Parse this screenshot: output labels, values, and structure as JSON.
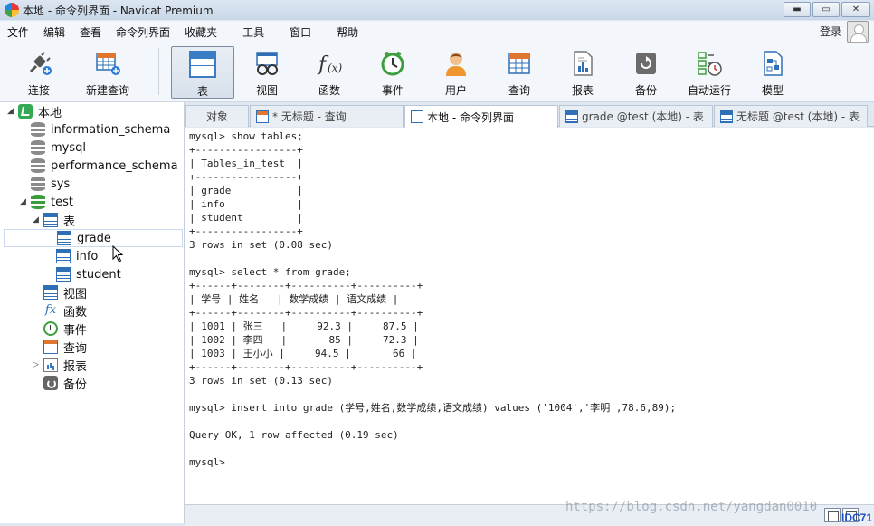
{
  "window": {
    "title": "本地 - 命令列界面 - Navicat Premium",
    "controls": {
      "minimize": "▬",
      "maximize": "▭",
      "close": "✕"
    }
  },
  "menubar": {
    "items": [
      "文件",
      "编辑",
      "查看",
      "命令列界面",
      "收藏夹",
      "工具",
      "窗口",
      "帮助"
    ],
    "login": "登录"
  },
  "toolbar": {
    "items": [
      {
        "label": "连接",
        "icon": "plug-icon"
      },
      {
        "label": "新建查询",
        "icon": "new-query-icon"
      },
      {
        "label": "表",
        "icon": "table-icon",
        "active": true
      },
      {
        "label": "视图",
        "icon": "view-icon"
      },
      {
        "label": "函数",
        "icon": "function-icon"
      },
      {
        "label": "事件",
        "icon": "event-icon"
      },
      {
        "label": "用户",
        "icon": "user-icon"
      },
      {
        "label": "查询",
        "icon": "query-icon"
      },
      {
        "label": "报表",
        "icon": "report-icon"
      },
      {
        "label": "备份",
        "icon": "backup-icon"
      },
      {
        "label": "自动运行",
        "icon": "schedule-icon"
      },
      {
        "label": "模型",
        "icon": "model-icon"
      }
    ]
  },
  "tree": {
    "connection": "本地",
    "databases": [
      "information_schema",
      "mysql",
      "performance_schema",
      "sys",
      "test"
    ],
    "test_children": {
      "tables_group": "表",
      "tables": [
        "grade",
        "info",
        "student"
      ],
      "views": "视图",
      "functions": "函数",
      "events": "事件",
      "queries": "查询",
      "reports": "报表",
      "backups": "备份"
    }
  },
  "tabs": [
    {
      "label": "对象"
    },
    {
      "label": "* 无标题 - 查询"
    },
    {
      "label": "本地 - 命令列界面",
      "active": true
    },
    {
      "label": "grade @test (本地) - 表"
    },
    {
      "label": "无标题 @test (本地) - 表"
    }
  ],
  "console": {
    "lines": [
      "mysql> show tables;",
      "+-----------------+",
      "| Tables_in_test  |",
      "+-----------------+",
      "| grade           |",
      "| info            |",
      "| student         |",
      "+-----------------+",
      "3 rows in set (0.08 sec)",
      "",
      "mysql> select * from grade;",
      "+------+--------+----------+----------+",
      "| 学号 | 姓名   | 数学成绩 | 语文成绩 |",
      "+------+--------+----------+----------+",
      "| 1001 | 张三   |     92.3 |     87.5 |",
      "| 1002 | 李四   |       85 |     72.3 |",
      "| 1003 | 王小小 |     94.5 |       66 |",
      "+------+--------+----------+----------+",
      "3 rows in set (0.13 sec)",
      "",
      "mysql> insert into grade (学号,姓名,数学成绩,语文成绩) values ('1004','李明',78.6,89);",
      "",
      "Query OK, 1 row affected (0.19 sec)",
      "",
      "mysql> "
    ]
  },
  "watermark": "https://blog.csdn.net/yangdan0010",
  "corner_logo": "IDC71"
}
